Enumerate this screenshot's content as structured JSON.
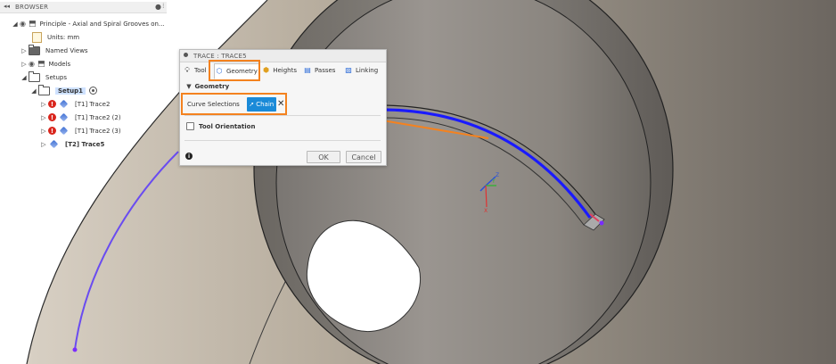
{
  "browser": {
    "title": "BROWSER",
    "document_name": "Principle - Axial and Spiral Grooves on...",
    "units": "Units: mm",
    "named_views": "Named Views",
    "models": "Models",
    "setups": "Setups",
    "setup1": "Setup1",
    "operations": [
      {
        "label": "[T1] Trace2",
        "error": true
      },
      {
        "label": "[T1] Trace2 (2)",
        "error": true
      },
      {
        "label": "[T1] Trace2 (3)",
        "error": true
      },
      {
        "label": "[T2] Trace5",
        "error": false
      }
    ]
  },
  "dialog": {
    "title": "TRACE : TRACE5",
    "tabs": [
      {
        "label": "Tool",
        "icon": "bulb-icon",
        "active": false
      },
      {
        "label": "Geometry",
        "icon": "geometry-icon",
        "active": true
      },
      {
        "label": "Heights",
        "icon": "heights-icon",
        "active": false
      },
      {
        "label": "Passes",
        "icon": "passes-icon",
        "active": false
      },
      {
        "label": "Linking",
        "icon": "linking-icon",
        "active": false
      }
    ],
    "section_geometry": "Geometry",
    "curve_selections_label": "Curve Selections",
    "chain_label": "Chain",
    "tool_orientation": "Tool Orientation",
    "ok_label": "OK",
    "cancel_label": "Cancel"
  },
  "triad": {
    "x": "X",
    "y": "Y",
    "z": "Z"
  },
  "colors": {
    "highlight": "#f4821f",
    "chain_button": "#1a8ad8",
    "toolpath": "#6a4cf0",
    "selected_curve": "#1a1aff"
  }
}
